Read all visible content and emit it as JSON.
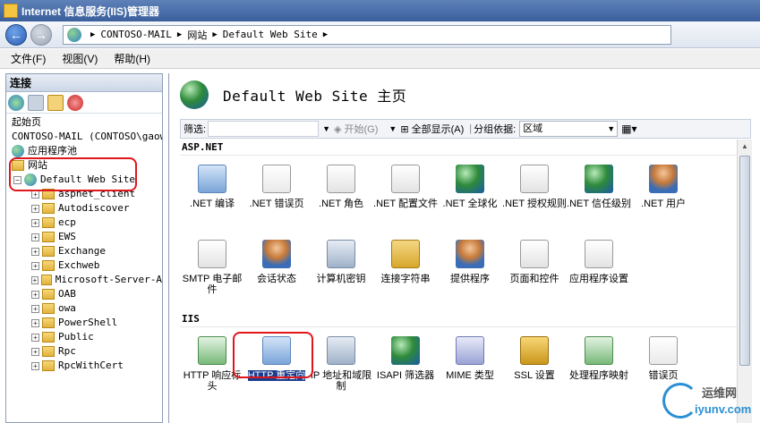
{
  "window": {
    "title": "Internet 信息服务(IIS)管理器"
  },
  "address": {
    "segments": [
      "CONTOSO-MAIL",
      "网站",
      "Default Web Site"
    ]
  },
  "menu": {
    "file": "文件(F)",
    "view": "视图(V)",
    "help": "帮助(H)"
  },
  "connections": {
    "header": "连接",
    "start_page": "起始页",
    "server": "CONTOSO-MAIL (CONTOSO\\gaower",
    "app_pools": "应用程序池",
    "sites": "网站",
    "default_site": "Default Web Site",
    "children": [
      "aspnet_client",
      "Autodiscover",
      "ecp",
      "EWS",
      "Exchange",
      "Exchweb",
      "Microsoft-Server-A",
      "OAB",
      "owa",
      "PowerShell",
      "Public",
      "Rpc",
      "RpcWithCert"
    ]
  },
  "main": {
    "title": "Default Web Site 主页",
    "filter": {
      "label": "筛选:",
      "start": "开始(G)",
      "show_all": "全部显示(A)",
      "group_by": "分组依据:",
      "group_value": "区域"
    },
    "groups": [
      {
        "name": "ASP.NET",
        "rows": [
          [
            {
              "label": ".NET 编译",
              "icon": "compile-icon"
            },
            {
              "label": ".NET 错误页",
              "icon": "error-page-icon"
            },
            {
              "label": ".NET 角色",
              "icon": "roles-icon"
            },
            {
              "label": ".NET 配置文件",
              "icon": "profile-icon"
            },
            {
              "label": ".NET 全球化",
              "icon": "globalization-icon"
            },
            {
              "label": ".NET 授权规则",
              "icon": "authorization-icon"
            },
            {
              "label": ".NET 信任级别",
              "icon": "trust-icon"
            },
            {
              "label": ".NET 用户",
              "icon": "users-icon"
            }
          ],
          [
            {
              "label": "SMTP 电子邮件",
              "icon": "smtp-icon"
            },
            {
              "label": "会话状态",
              "icon": "session-icon"
            },
            {
              "label": "计算机密钥",
              "icon": "machine-key-icon"
            },
            {
              "label": "连接字符串",
              "icon": "connection-string-icon"
            },
            {
              "label": "提供程序",
              "icon": "providers-icon"
            },
            {
              "label": "页面和控件",
              "icon": "pages-controls-icon"
            },
            {
              "label": "应用程序设置",
              "icon": "app-settings-icon"
            }
          ]
        ]
      },
      {
        "name": "IIS",
        "rows": [
          [
            {
              "label": "HTTP 响应标头",
              "icon": "response-headers-icon"
            },
            {
              "label": "HTTP 重定向",
              "icon": "redirect-icon"
            },
            {
              "label": "IP 地址和域限制",
              "icon": "ip-restrict-icon"
            },
            {
              "label": "ISAPI 筛选器",
              "icon": "isapi-icon"
            },
            {
              "label": "MIME 类型",
              "icon": "mime-icon"
            },
            {
              "label": "SSL 设置",
              "icon": "ssl-icon"
            },
            {
              "label": "处理程序映射",
              "icon": "handler-icon"
            },
            {
              "label": "错误页",
              "icon": "errors-icon"
            }
          ]
        ]
      }
    ]
  },
  "watermark": {
    "line1": "运维网",
    "line2": "iyunv.com"
  }
}
